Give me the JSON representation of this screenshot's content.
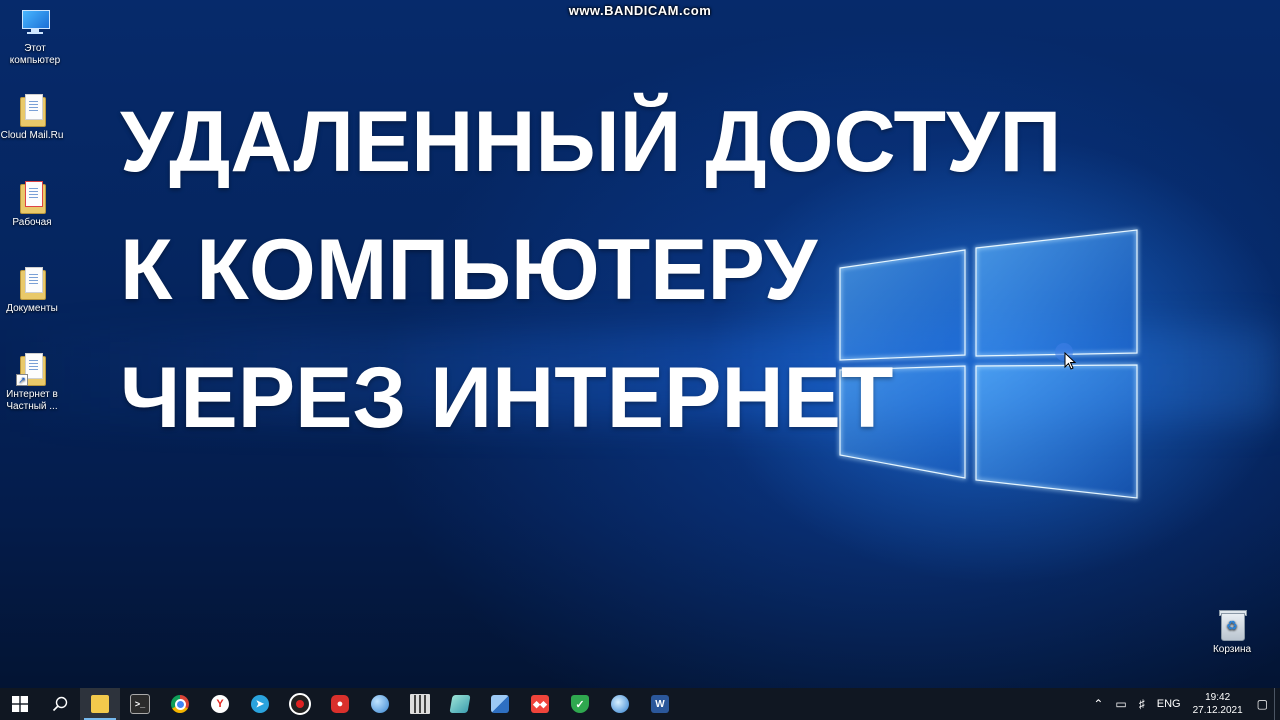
{
  "watermark": "www.BANDICAM.com",
  "headline": {
    "line1": "УДАЛЕННЫЙ ДОСТУП",
    "line2": "К КОМПЬЮТЕРУ",
    "line3": "ЧЕРЕЗ ИНТЕРНЕТ"
  },
  "desktop_icons": {
    "this_pc": {
      "label": "Этот компьютер",
      "icon": "computer-icon"
    },
    "cloud_mail": {
      "label": "Cloud Mail.Ru",
      "icon": "folder-icon"
    },
    "workspace": {
      "label": "Рабочая",
      "icon": "folder-icon"
    },
    "documents": {
      "label": "Документы",
      "icon": "folder-icon"
    },
    "internet_shortcut": {
      "label": "Интернет в Частный ...",
      "icon": "folder-shortcut-icon"
    },
    "recycle_bin": {
      "label": "Корзина",
      "icon": "recycle-bin-icon"
    }
  },
  "taskbar": {
    "apps": [
      {
        "name": "start",
        "icon": "windows-logo-icon"
      },
      {
        "name": "search",
        "icon": "search-icon"
      },
      {
        "name": "file-explorer",
        "icon": "folder-icon",
        "active": true
      },
      {
        "name": "terminal",
        "icon": "console-icon"
      },
      {
        "name": "chrome",
        "icon": "chrome-icon"
      },
      {
        "name": "yandex-browser",
        "icon": "yandex-icon"
      },
      {
        "name": "telegram",
        "icon": "telegram-icon"
      },
      {
        "name": "recorder",
        "icon": "record-icon"
      },
      {
        "name": "red-app",
        "icon": "red-hexagon-icon"
      },
      {
        "name": "globe-app",
        "icon": "globe-icon"
      },
      {
        "name": "calculator",
        "icon": "calculator-icon"
      },
      {
        "name": "notes",
        "icon": "notes-icon"
      },
      {
        "name": "network-app",
        "icon": "network-computers-icon"
      },
      {
        "name": "anydesk",
        "icon": "anydesk-icon"
      },
      {
        "name": "shield-app",
        "icon": "shield-icon"
      },
      {
        "name": "remote-app",
        "icon": "remote-globe-icon"
      },
      {
        "name": "word",
        "icon": "word-icon"
      }
    ],
    "tray": {
      "language": "ENG",
      "time": "19:42",
      "date": "27.12.2021"
    }
  },
  "colors": {
    "taskbar": "#101722",
    "desktop_dark": "#041c4b",
    "logo_glow": "#6fc2ff"
  }
}
